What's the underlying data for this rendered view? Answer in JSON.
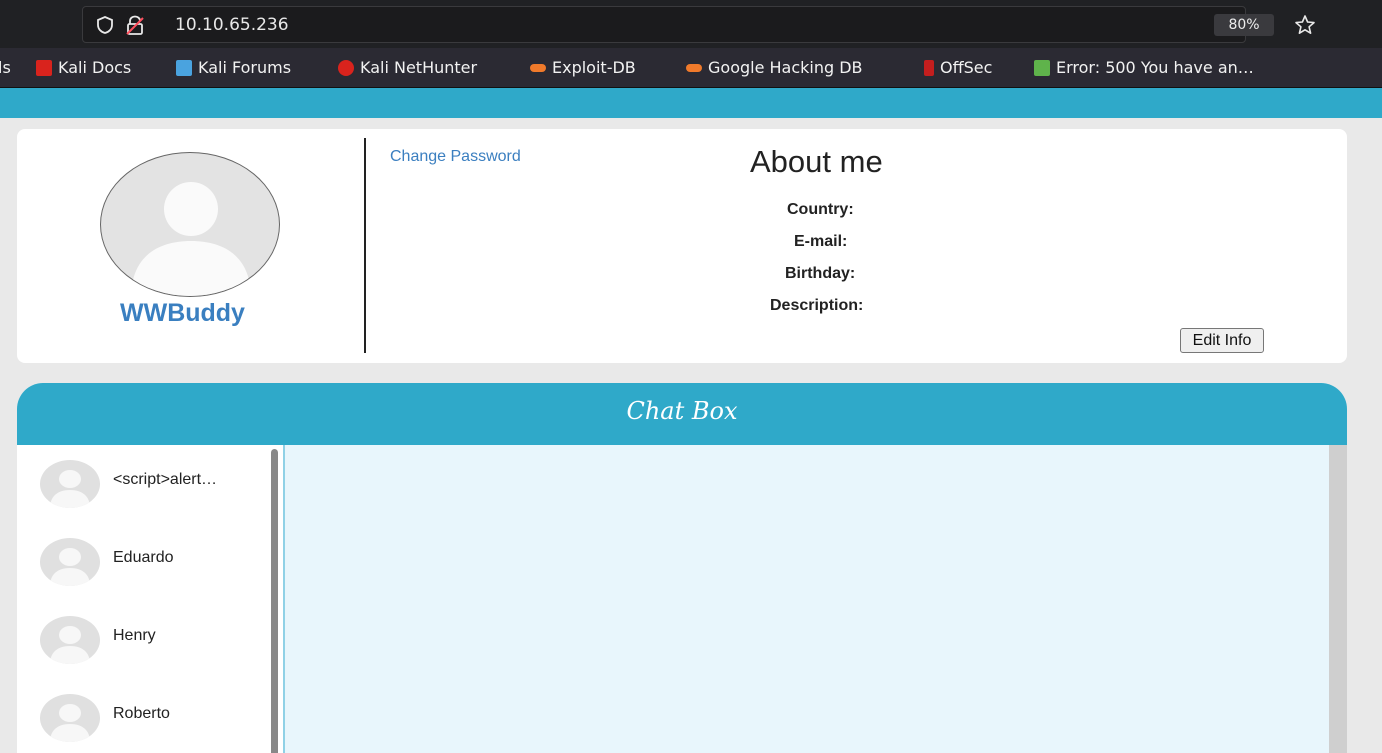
{
  "browser": {
    "url": "10.10.65.236",
    "zoom": "80%"
  },
  "bookmarks": [
    {
      "label": "ls",
      "icon": "cut-off-bookmark",
      "color": "#2b2a33"
    },
    {
      "label": "Kali Docs",
      "icon": "kali-docs-icon",
      "color": "#d9231d"
    },
    {
      "label": "Kali Forums",
      "icon": "kali-forums-icon",
      "color": "#4aa3df"
    },
    {
      "label": "Kali NetHunter",
      "icon": "kali-nethunter-icon",
      "color": "#d9231d"
    },
    {
      "label": "Exploit-DB",
      "icon": "exploit-db-icon",
      "color": "#f07a2b"
    },
    {
      "label": "Google Hacking DB",
      "icon": "ghdb-icon",
      "color": "#f07a2b"
    },
    {
      "label": "OffSec",
      "icon": "offsec-icon",
      "color": "#c41e1e"
    },
    {
      "label": "Error: 500 You have an…",
      "icon": "joomla-icon",
      "color": "#5fb34b"
    }
  ],
  "profile": {
    "username": "WWBuddy",
    "change_password": "Change Password",
    "about_title": "About me",
    "fields": {
      "country": "Country:",
      "email": "E-mail:",
      "birthday": "Birthday:",
      "description": "Description:"
    },
    "edit_button": "Edit Info"
  },
  "chat": {
    "title": "Chat Box",
    "contacts": [
      {
        "name": "<script>alert…"
      },
      {
        "name": "Eduardo"
      },
      {
        "name": "Henry"
      },
      {
        "name": "Roberto"
      }
    ]
  },
  "colors": {
    "accent": "#2fa9c9",
    "link": "#3b7fc0",
    "chat_bg": "#e8f6fc"
  }
}
